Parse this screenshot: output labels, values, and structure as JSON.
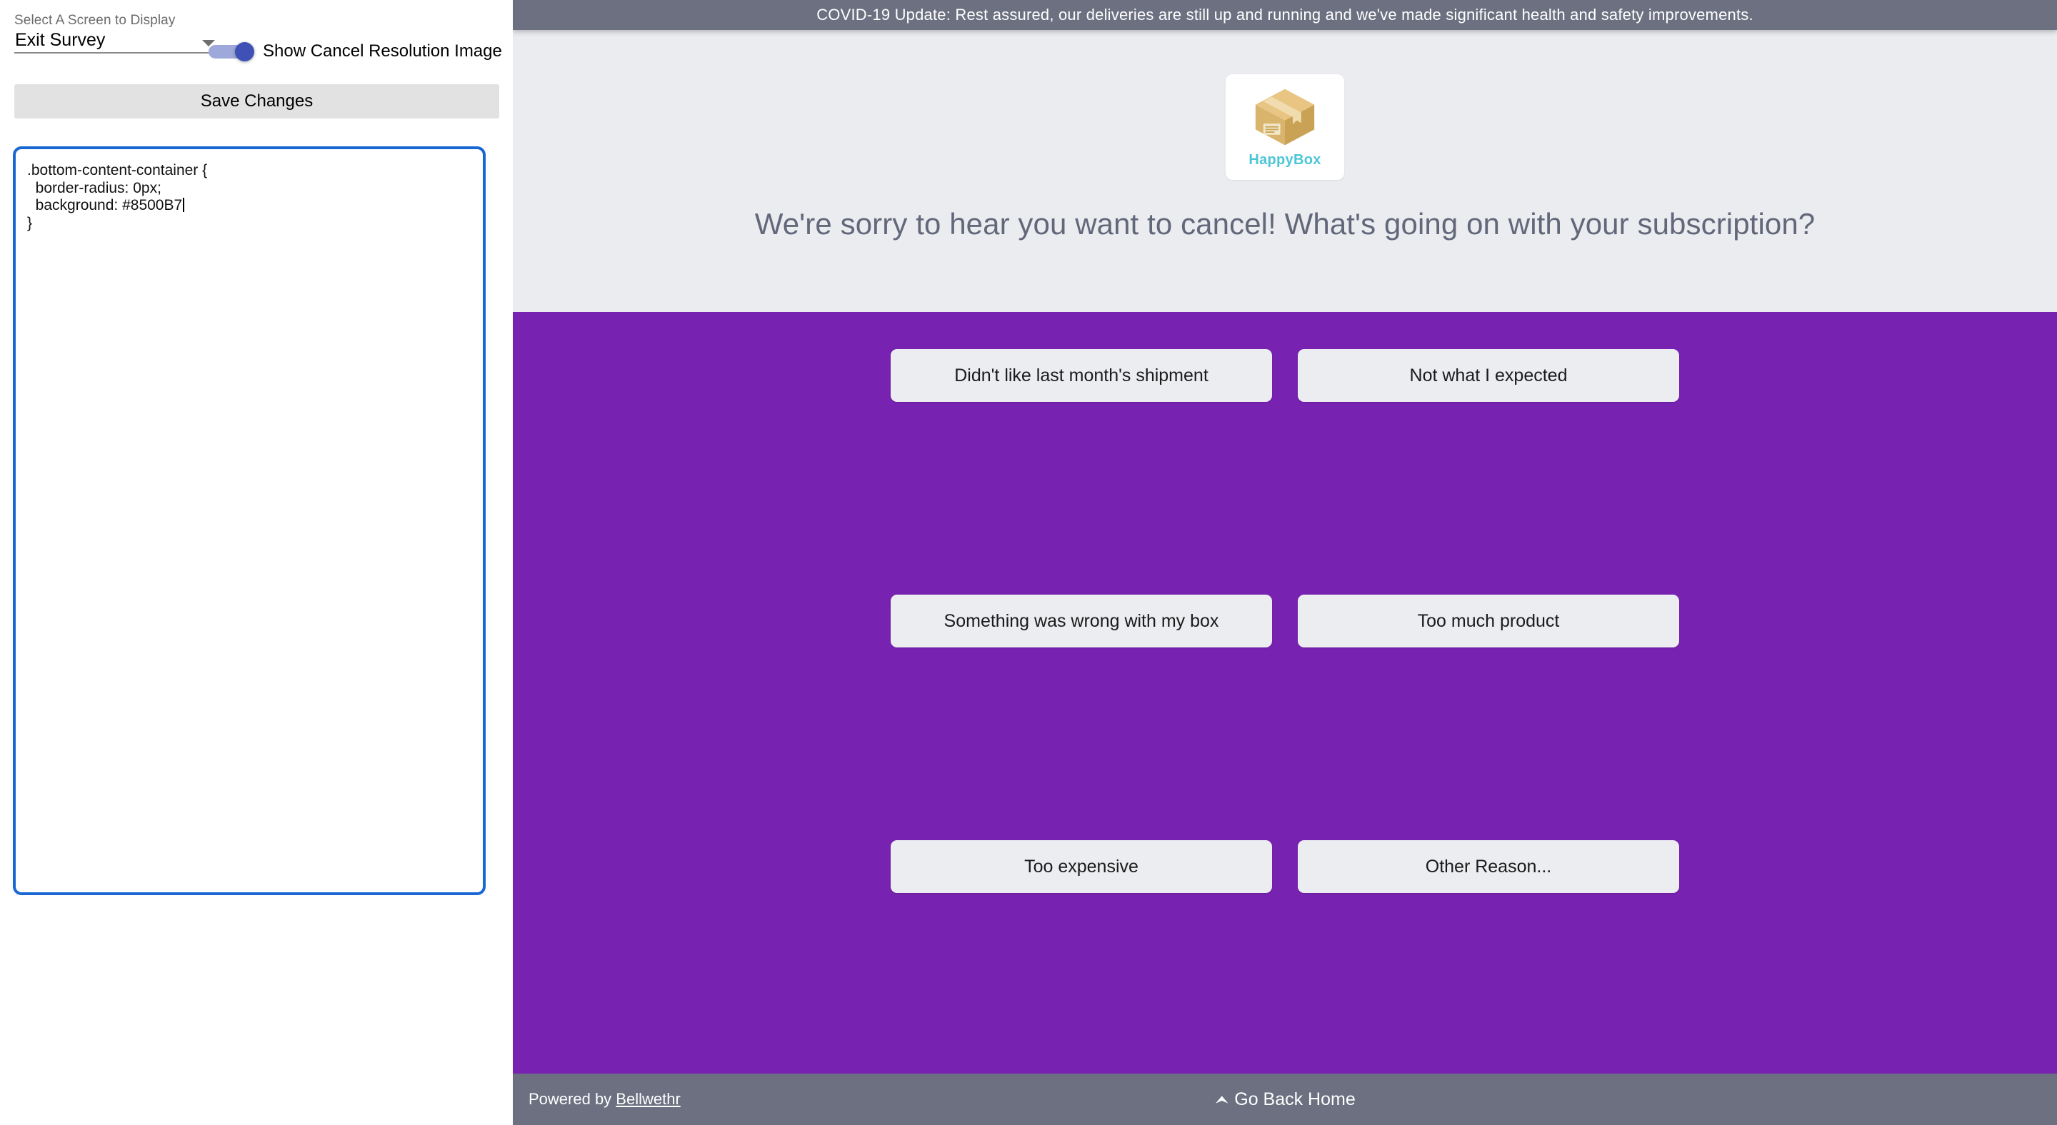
{
  "editor_panel": {
    "select_label": "Select A Screen to Display",
    "select_value": "Exit Survey",
    "select_options": [
      "Exit Survey"
    ],
    "caret_icon": "chevron-down-icon",
    "toggle": {
      "label": "Show Cancel Resolution Image",
      "state": "on",
      "track_color": "#9FA8DA",
      "knob_color": "#3F51B5"
    },
    "save_button": "Save Changes",
    "code": {
      "line1": ".bottom-content-container {",
      "line2": "  border-radius: 0px;",
      "line3": "  background: #8500B7",
      "line4": "}",
      "border_color": "#1967D2"
    }
  },
  "preview": {
    "banner": {
      "text": "COVID-19 Update: Rest assured, our deliveries are still up and running and we've made significant health and safety improvements.",
      "background": "#6C7080",
      "text_color": "#FFFFFF"
    },
    "logo": {
      "name": "HappyBox",
      "icon": "cardboard-box-icon",
      "text_color": "#4CC6D6"
    },
    "headline": "We're sorry to hear you want to cancel! What's going on with your subscription?",
    "top_background": "#EBECF0",
    "headline_color": "#62687A",
    "bottom_background": "#7722B0",
    "bottom_border_radius": "0px",
    "options": [
      "Didn't like last month's shipment",
      "Not what I expected",
      "Something was wrong with my box",
      "Too much product",
      "Too expensive",
      "Other Reason..."
    ],
    "option_background": "#ECEDF1",
    "footer": {
      "powered_prefix": "Powered by ",
      "brand": "Bellwethr",
      "home_label": "Go Back Home",
      "home_icon": "chevron-up-icon",
      "background": "#6C7080"
    }
  }
}
